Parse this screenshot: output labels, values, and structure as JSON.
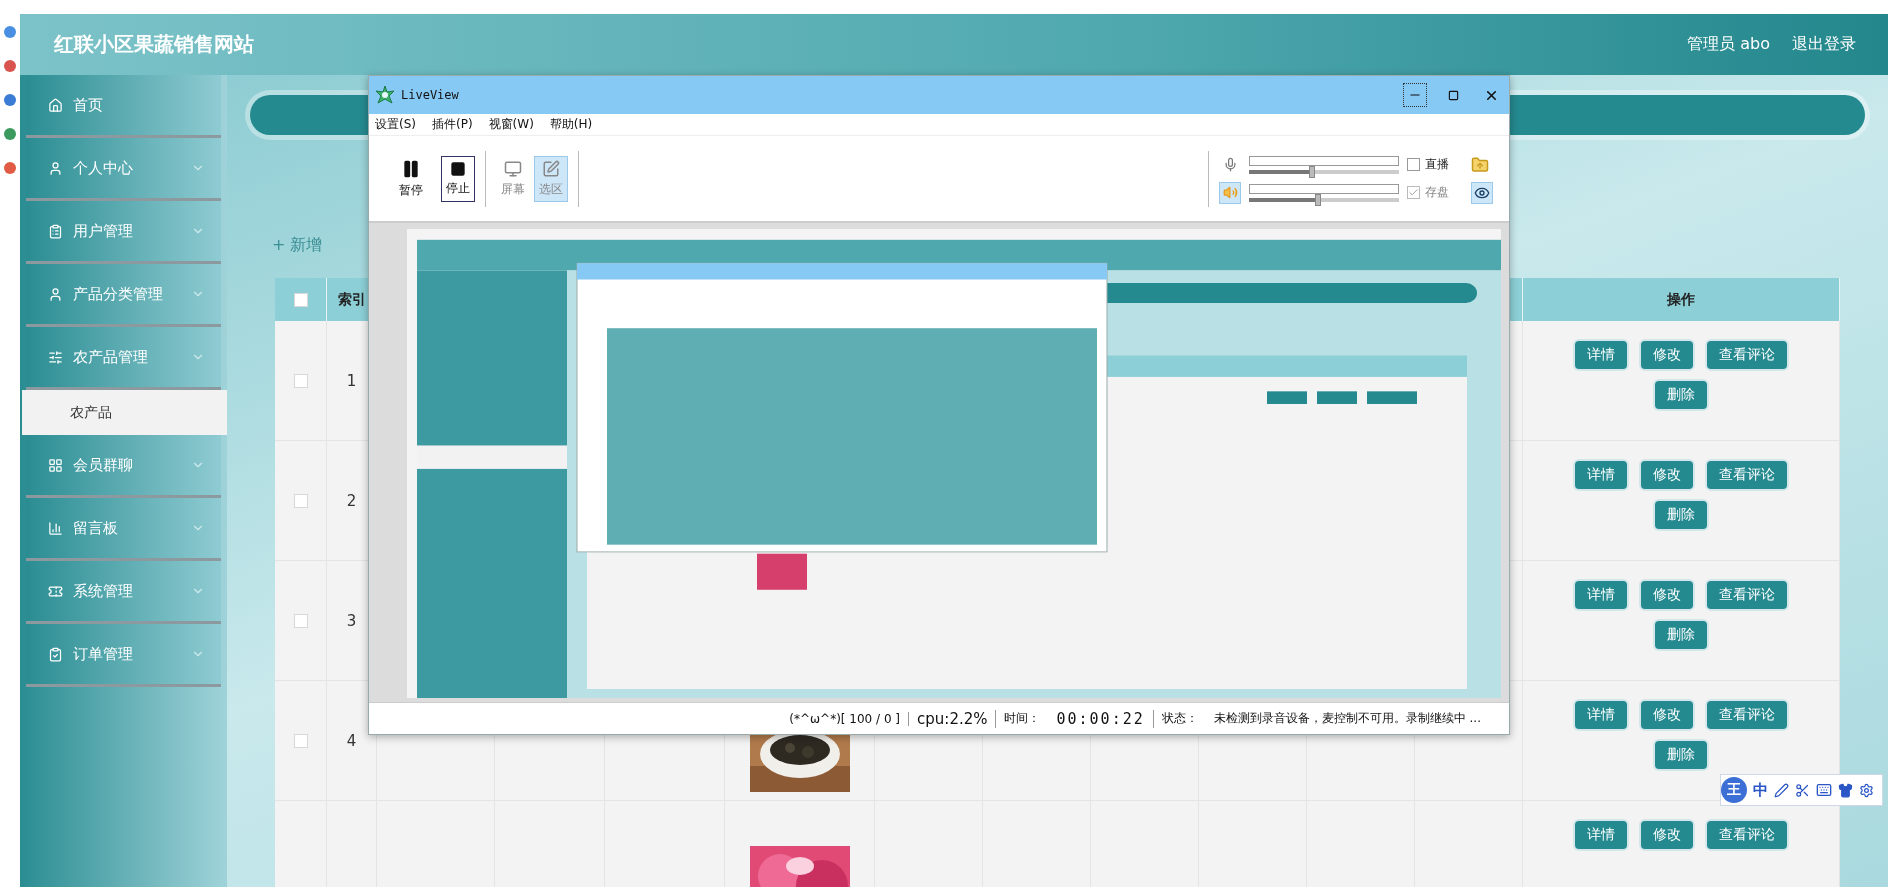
{
  "site": {
    "title": "红联小区果蔬销售网站",
    "user": "管理员 abo",
    "logout": "退出登录"
  },
  "sidebar": {
    "items": [
      {
        "label": "首页",
        "expandable": false
      },
      {
        "label": "个人中心",
        "expandable": true
      },
      {
        "label": "用户管理",
        "expandable": true
      },
      {
        "label": "产品分类管理",
        "expandable": true
      },
      {
        "label": "农产品管理",
        "expandable": true,
        "children": [
          {
            "label": "农产品",
            "selected": true
          }
        ]
      },
      {
        "label": "会员群聊",
        "expandable": true
      },
      {
        "label": "留言板",
        "expandable": true
      },
      {
        "label": "系统管理",
        "expandable": true
      },
      {
        "label": "订单管理",
        "expandable": true
      }
    ]
  },
  "add_button": "+ 新增",
  "table": {
    "header_checkbox": {
      "checked": false
    },
    "index_column": "索引",
    "actions_column": "操作",
    "rows": [
      {
        "checkbox": {
          "checked": false
        },
        "index": "1",
        "actions": [
          "详情",
          "修改",
          "查看评论",
          "删除"
        ]
      },
      {
        "checkbox": {
          "checked": false
        },
        "index": "2",
        "actions": [
          "详情",
          "修改",
          "查看评论",
          "删除"
        ]
      },
      {
        "checkbox": {
          "checked": false
        },
        "index": "3",
        "actions": [
          "详情",
          "修改",
          "查看评论",
          "删除"
        ]
      },
      {
        "checkbox": {
          "checked": false
        },
        "index": "4",
        "image": {
          "kind": "picture"
        },
        "actions": [
          "详情",
          "修改",
          "查看评论",
          "删除"
        ]
      },
      {
        "image": {
          "kind": "picture"
        },
        "actions": [
          "详情",
          "修改",
          "查看评论"
        ]
      }
    ]
  },
  "liveview": {
    "title": "LiveView",
    "menu": [
      "设置(S)",
      "插件(P)",
      "视窗(W)",
      "帮助(H)"
    ],
    "tools": [
      {
        "kind": "pause",
        "label": "暂停",
        "selected": false,
        "disabled": false
      },
      {
        "kind": "stop",
        "label": "停止",
        "selected": true,
        "disabled": false
      },
      {
        "kind": "screen",
        "label": "屏幕",
        "selected": false,
        "disabled": true
      },
      {
        "kind": "region",
        "label": "选区",
        "selected": true,
        "disabled": true
      }
    ],
    "audio": [
      {
        "kind": "mic",
        "selected": false,
        "level": 0.42,
        "option": {
          "label": "直播",
          "checked": false,
          "disabled": false
        }
      },
      {
        "kind": "speaker",
        "selected": true,
        "level": 0.46,
        "option": {
          "label": "存盘",
          "checked": true,
          "disabled": true
        }
      }
    ],
    "preview": {
      "kind": "picture"
    },
    "status": {
      "fps": "(*^ω^*)[ 100 / 0 ]",
      "cpu": "cpu:2.2%",
      "time_label": "时间：",
      "time": "00:00:22",
      "state_label": "状态：",
      "state": "未检测到录音设备，麦控制不可用。录制继续中 ..."
    }
  },
  "ime": {
    "badge": "王",
    "mode": "中"
  }
}
